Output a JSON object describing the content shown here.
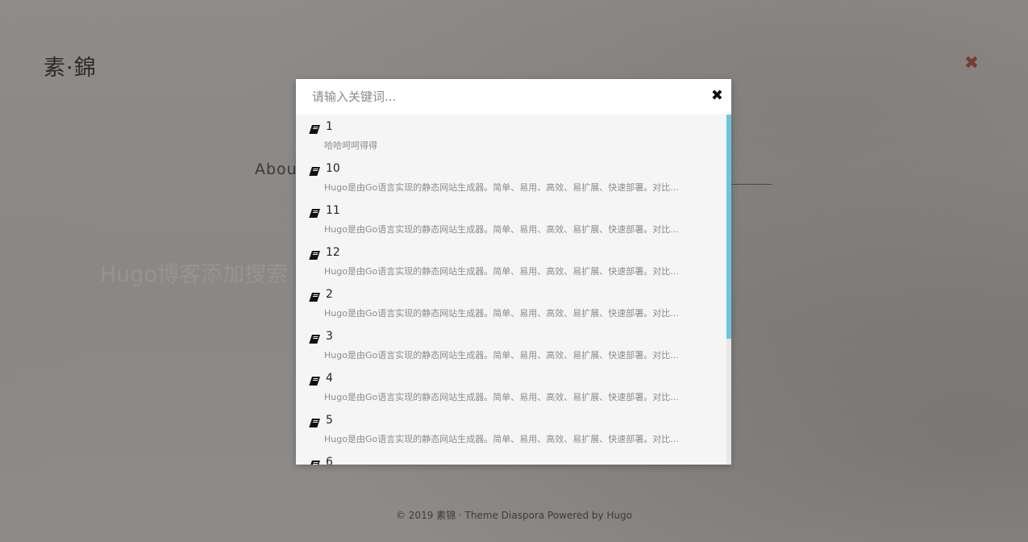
{
  "site": {
    "logo": "素·錦",
    "about_label": "About",
    "faded_post_title": "Hugo博客添加搜索",
    "footer": "© 2019 素锦 · Theme Diaspora Powered by Hugo"
  },
  "search": {
    "placeholder": "请输入关键词...",
    "close_symbol": "✖",
    "results": [
      {
        "title": "1",
        "desc": "哈哈呵呵得得"
      },
      {
        "title": "10",
        "desc": "Hugo是由Go语言实现的静态网站生成器。简单、易用、高效、易扩展、快速部署。对比..."
      },
      {
        "title": "11",
        "desc": "Hugo是由Go语言实现的静态网站生成器。简单、易用、高效、易扩展、快速部署。对比..."
      },
      {
        "title": "12",
        "desc": "Hugo是由Go语言实现的静态网站生成器。简单、易用、高效、易扩展、快速部署。对比..."
      },
      {
        "title": "2",
        "desc": "Hugo是由Go语言实现的静态网站生成器。简单、易用、高效、易扩展、快速部署。对比..."
      },
      {
        "title": "3",
        "desc": "Hugo是由Go语言实现的静态网站生成器。简单、易用、高效、易扩展、快速部署。对比..."
      },
      {
        "title": "4",
        "desc": "Hugo是由Go语言实现的静态网站生成器。简单、易用、高效、易扩展、快速部署。对比..."
      },
      {
        "title": "5",
        "desc": "Hugo是由Go语言实现的静态网站生成器。简单、易用、高效、易扩展、快速部署。对比..."
      },
      {
        "title": "6",
        "desc": ""
      }
    ]
  },
  "page_close_symbol": "✖",
  "colors": {
    "accent_scroll": "#6cc6db",
    "close_page": "#7a3b35"
  }
}
